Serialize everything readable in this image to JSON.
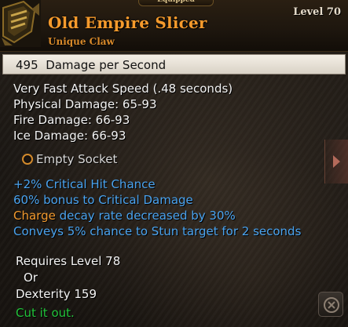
{
  "header": {
    "equipped_label": "Equipped",
    "name": "Old Empire Slicer",
    "type": "Unique Claw",
    "level": "Level 70"
  },
  "dps": {
    "value": "495",
    "label": "Damage per Second"
  },
  "base_stats": [
    "Very Fast Attack Speed (.48 seconds)",
    "Physical Damage: 65-93",
    "Fire Damage: 66-93",
    "Ice Damage: 66-93"
  ],
  "socket": {
    "label": "Empty Socket"
  },
  "modifiers": {
    "crit_chance": "+2% Critical Hit Chance",
    "crit_damage": "60% bonus to Critical Damage",
    "charge_keyword": "Charge",
    "charge_rest": "decay rate decreased by 30%",
    "stun": "Conveys 5% chance to Stun target for 2 seconds"
  },
  "requirements": {
    "level": "Requires Level 78",
    "or": "Or",
    "dexterity": "Dexterity 159"
  },
  "flavor": "Cut it out.",
  "colors": {
    "item_name": "#f59a2c",
    "modifier_blue": "#4aa3ef",
    "charge_orange": "#f39a2e",
    "flavor_green": "#22c43b"
  },
  "icons": [
    "claw-item-icon",
    "arrow-right-icon",
    "corner-button-icon"
  ]
}
